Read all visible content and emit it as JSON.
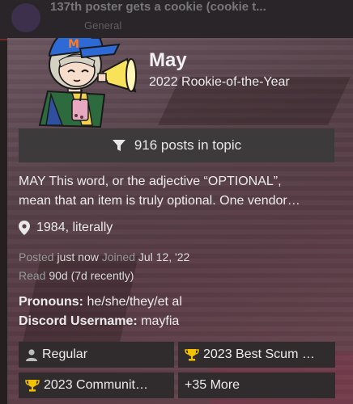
{
  "topic": {
    "title": "137th poster gets a cookie (cookie t...",
    "category": "General"
  },
  "user": {
    "name": "May",
    "title": "2022 Rookie-of-the-Year",
    "posts_button": "916 posts in topic",
    "bio_line1": "MAY This word, or the adjective “OPTIONAL”,",
    "bio_line2": "mean that an item is truly optional. One vendor…",
    "location": "1984, literally",
    "posted_label": "Posted",
    "posted_value": "just now",
    "joined_label": "Joined",
    "joined_value": "Jul 12, '22",
    "read_label": "Read",
    "read_value": "90d (7d recently)",
    "pronouns_label": "Pronouns:",
    "pronouns_value": "he/she/they/et al",
    "discord_label": "Discord Username:",
    "discord_value": "mayfia"
  },
  "badges": [
    {
      "label": "Regular",
      "icon": "user-icon"
    },
    {
      "label": "2023 Best Scum …",
      "icon": "trophy-icon"
    },
    {
      "label": "2023 Communit…",
      "icon": "trophy-icon"
    },
    {
      "label": "+35 More",
      "icon": ""
    }
  ],
  "colors": {
    "trophy": "#f2c200",
    "card_bg": "#5a3d47",
    "button_bg": "#3d3a3b"
  }
}
